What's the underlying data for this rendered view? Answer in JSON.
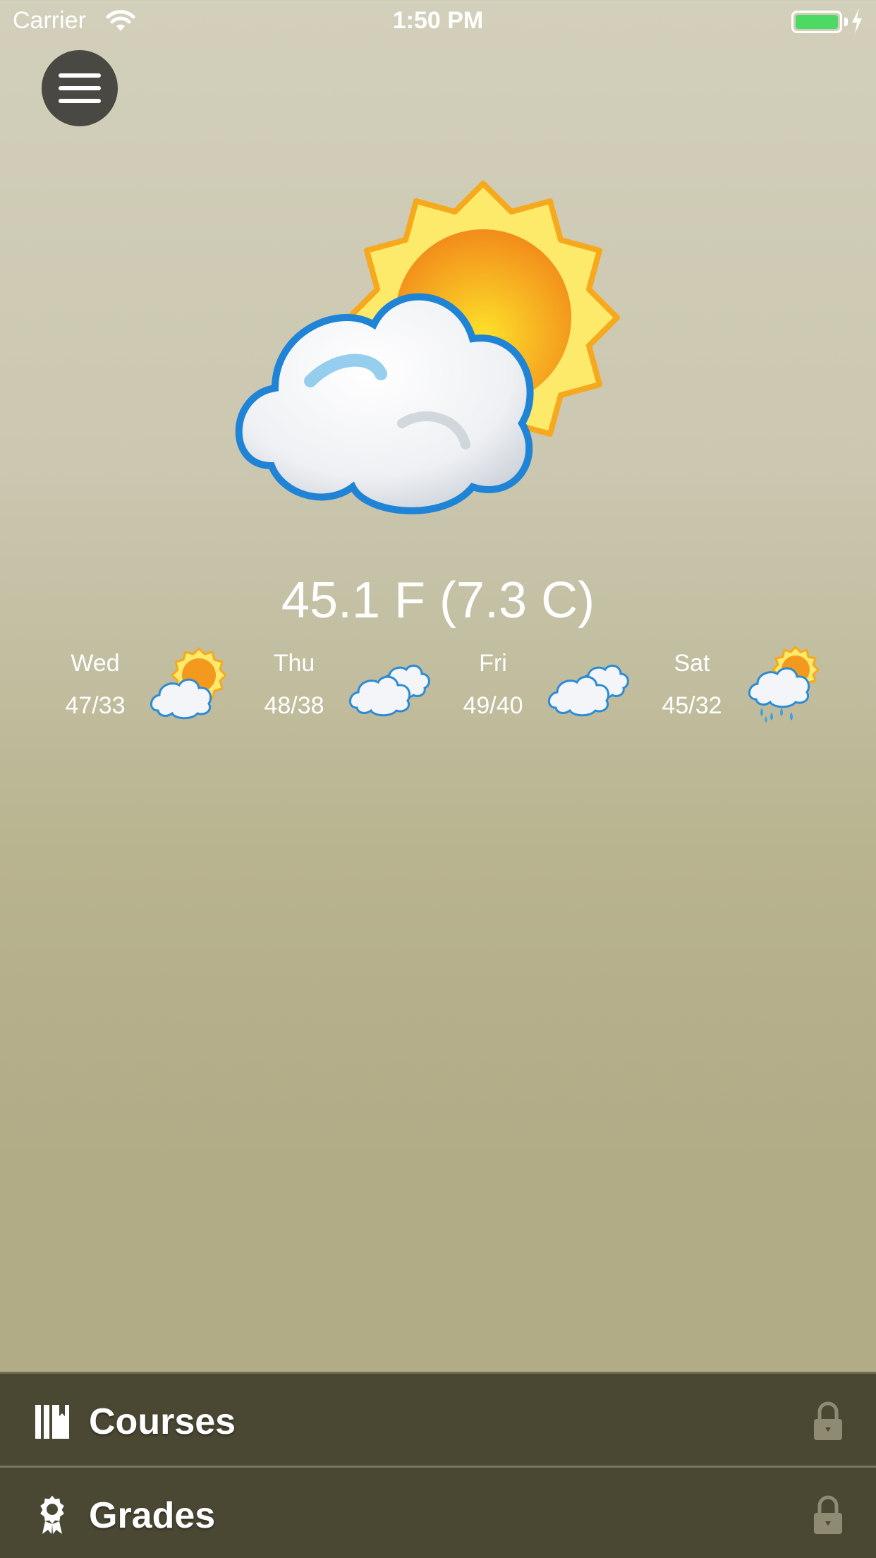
{
  "status_bar": {
    "carrier": "Carrier",
    "time": "1:50 PM",
    "battery_color": "#4cd964"
  },
  "menu": {
    "icon": "hamburger-menu-icon"
  },
  "current": {
    "icon": "partly-cloudy-icon",
    "temperature": "45.1 F (7.3 C)"
  },
  "forecast": [
    {
      "day": "Wed",
      "range": "47/33",
      "icon": "partly-cloudy-icon"
    },
    {
      "day": "Thu",
      "range": "48/38",
      "icon": "cloudy-icon"
    },
    {
      "day": "Fri",
      "range": "49/40",
      "icon": "cloudy-icon"
    },
    {
      "day": "Sat",
      "range": "45/32",
      "icon": "rain-sun-icon"
    }
  ],
  "bottom_menu": [
    {
      "label": "Courses",
      "icon": "book-icon",
      "locked": true
    },
    {
      "label": "Grades",
      "icon": "award-icon",
      "locked": true
    }
  ],
  "colors": {
    "panel": "#4a4733",
    "background_top": "#d2cfbb",
    "background_bottom": "#b1ab86"
  }
}
